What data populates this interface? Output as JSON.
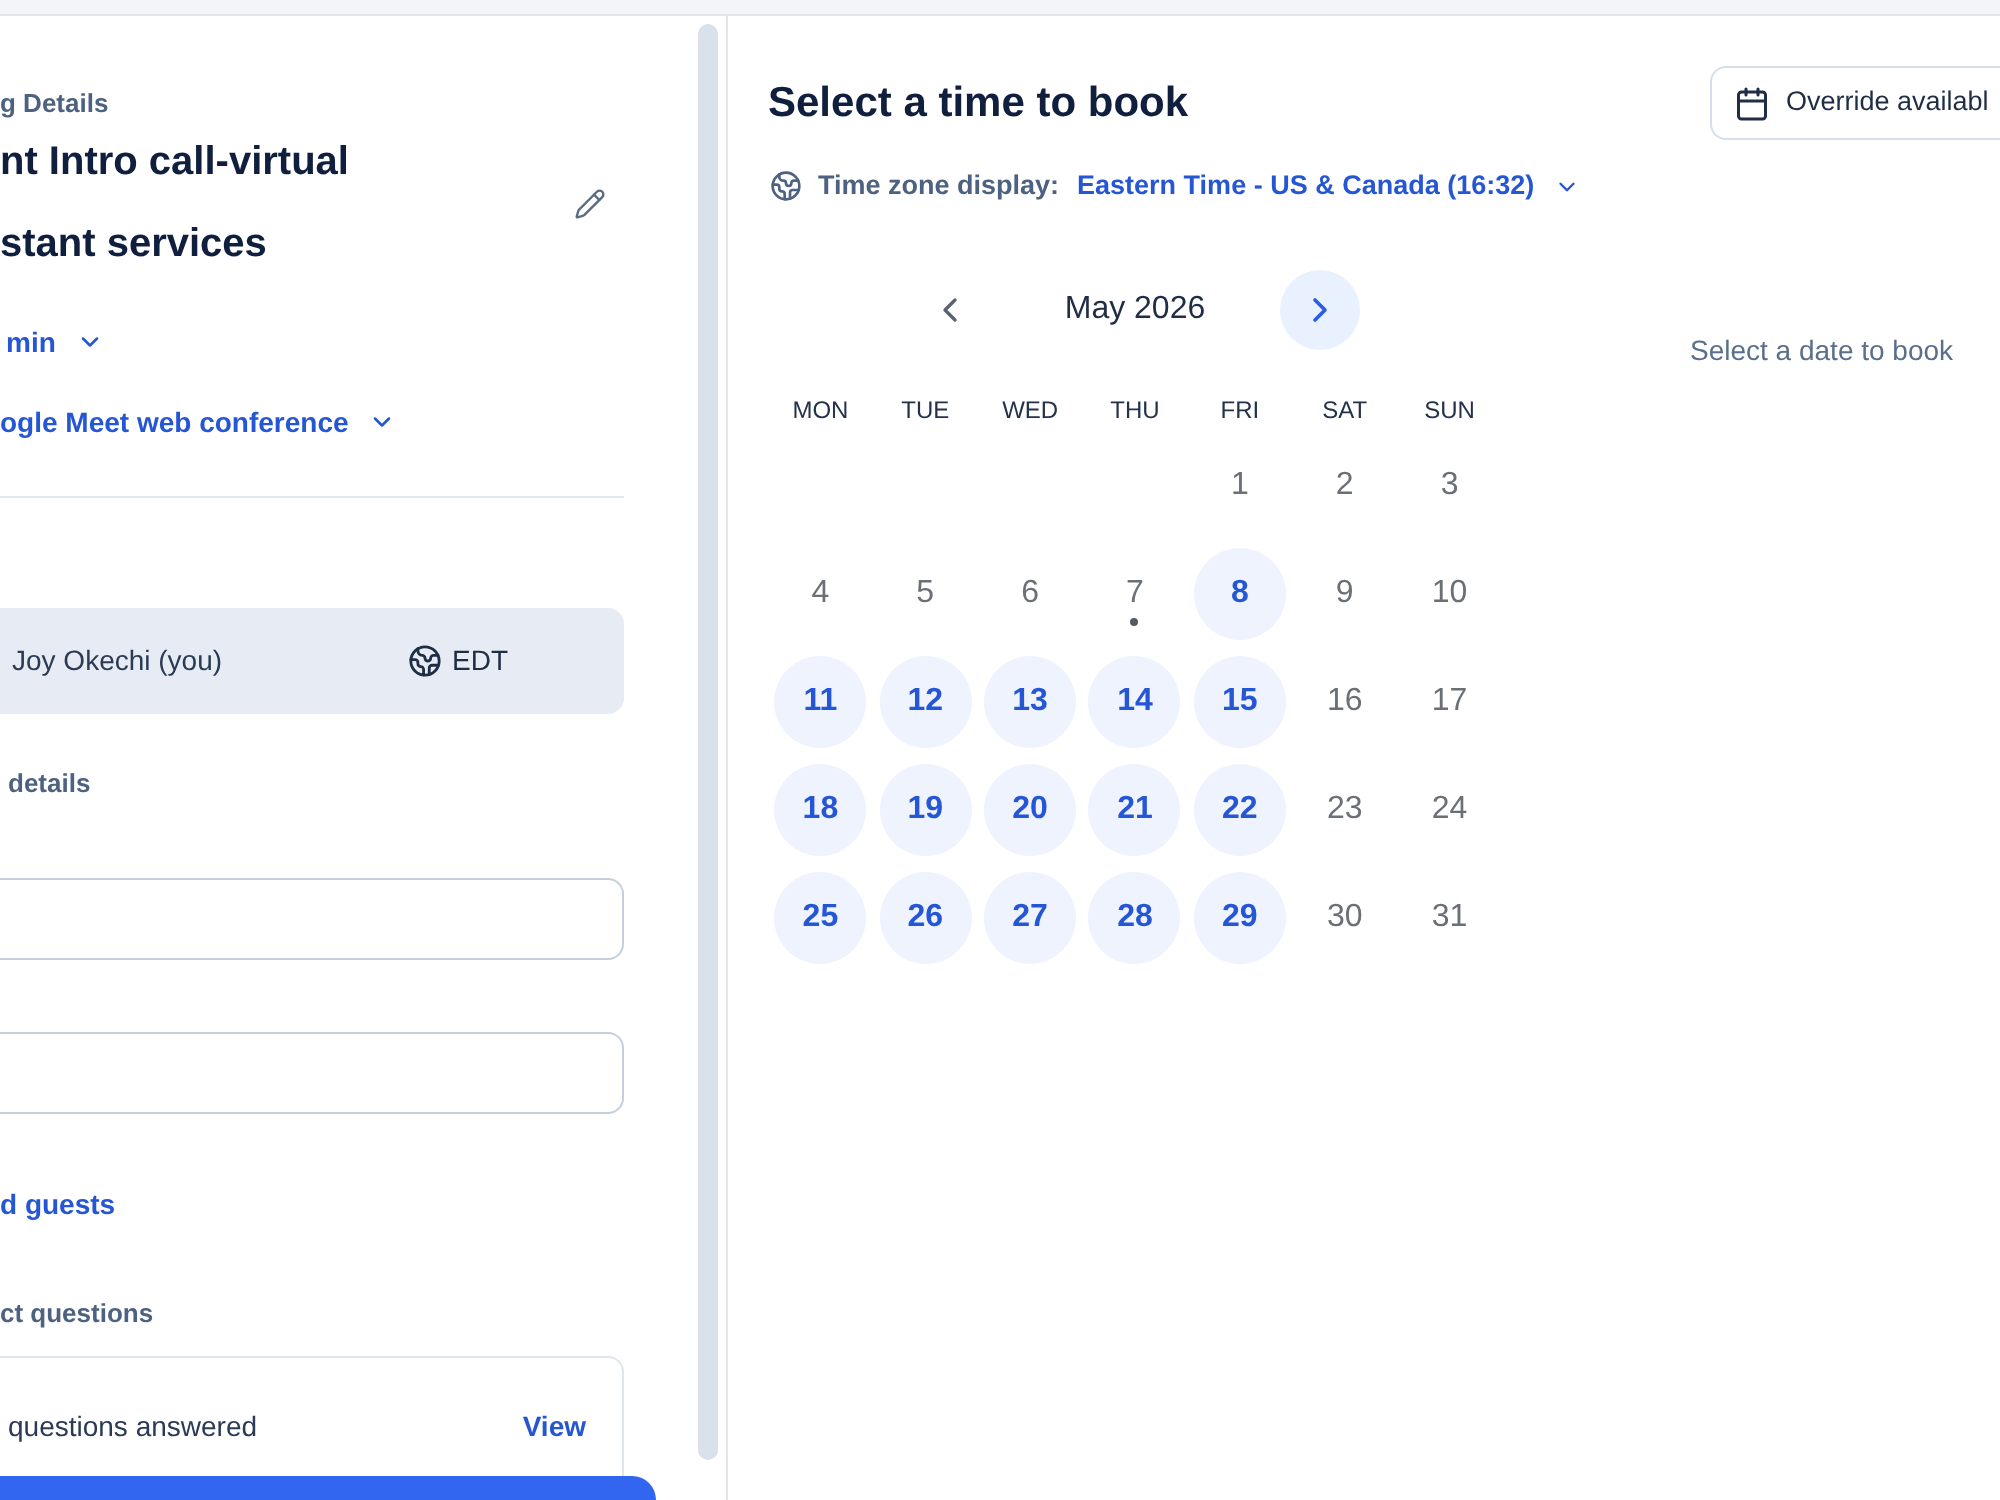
{
  "meeting_panel": {
    "section_label": "g Details",
    "title_lines": [
      "nt Intro call-virtual",
      "stant services"
    ],
    "duration": {
      "label": "min"
    },
    "location": {
      "label": "ogle Meet web conference"
    },
    "host": {
      "name": "Joy Okechi (you)",
      "timezone": "EDT"
    },
    "details_label": "details",
    "fields": [
      {
        "kind": "text"
      },
      {
        "kind": "text"
      }
    ],
    "guests_link": "d guests",
    "questions_label": "ct questions",
    "questions_card": {
      "summary": "questions answered",
      "action": "View"
    },
    "footer_button": {
      "kind": "primary"
    }
  },
  "booking": {
    "title": "Select a time to book",
    "override_button": "Override availabl",
    "timezone": {
      "label": "Time zone display:",
      "value": "Eastern Time - US & Canada (16:32)"
    },
    "calendar": {
      "month": "May 2026",
      "weekdays": [
        "MON",
        "TUE",
        "WED",
        "THU",
        "FRI",
        "SAT",
        "SUN"
      ],
      "weeks": [
        {
          "days": [
            {
              "label": "1",
              "available": false,
              "today": false
            },
            {
              "label": "2",
              "available": false,
              "today": false
            },
            {
              "label": "3",
              "available": false,
              "today": false
            }
          ]
        },
        {
          "days": [
            {
              "label": "4",
              "available": false,
              "today": false
            },
            {
              "label": "5",
              "available": false,
              "today": false
            },
            {
              "label": "6",
              "available": false,
              "today": false
            },
            {
              "label": "7",
              "available": false,
              "today": true
            },
            {
              "label": "8",
              "available": true,
              "today": false
            },
            {
              "label": "9",
              "available": false,
              "today": false
            },
            {
              "label": "10",
              "available": false,
              "today": false
            }
          ]
        },
        {
          "days": [
            {
              "label": "11",
              "available": true,
              "today": false
            },
            {
              "label": "12",
              "available": true,
              "today": false
            },
            {
              "label": "13",
              "available": true,
              "today": false
            },
            {
              "label": "14",
              "available": true,
              "today": false
            },
            {
              "label": "15",
              "available": true,
              "today": false
            },
            {
              "label": "16",
              "available": false,
              "today": false
            },
            {
              "label": "17",
              "available": false,
              "today": false
            }
          ]
        },
        {
          "days": [
            {
              "label": "18",
              "available": true,
              "today": false
            },
            {
              "label": "19",
              "available": true,
              "today": false
            },
            {
              "label": "20",
              "available": true,
              "today": false
            },
            {
              "label": "21",
              "available": true,
              "today": false
            },
            {
              "label": "22",
              "available": true,
              "today": false
            },
            {
              "label": "23",
              "available": false,
              "today": false
            },
            {
              "label": "24",
              "available": false,
              "today": false
            }
          ]
        },
        {
          "days": [
            {
              "label": "25",
              "available": true,
              "today": false
            },
            {
              "label": "26",
              "available": true,
              "today": false
            },
            {
              "label": "27",
              "available": true,
              "today": false
            },
            {
              "label": "28",
              "available": true,
              "today": false
            },
            {
              "label": "29",
              "available": true,
              "today": false
            },
            {
              "label": "30",
              "available": false,
              "today": false
            },
            {
              "label": "31",
              "available": false,
              "today": false
            }
          ]
        }
      ]
    },
    "hint": "Select a date to book"
  }
}
